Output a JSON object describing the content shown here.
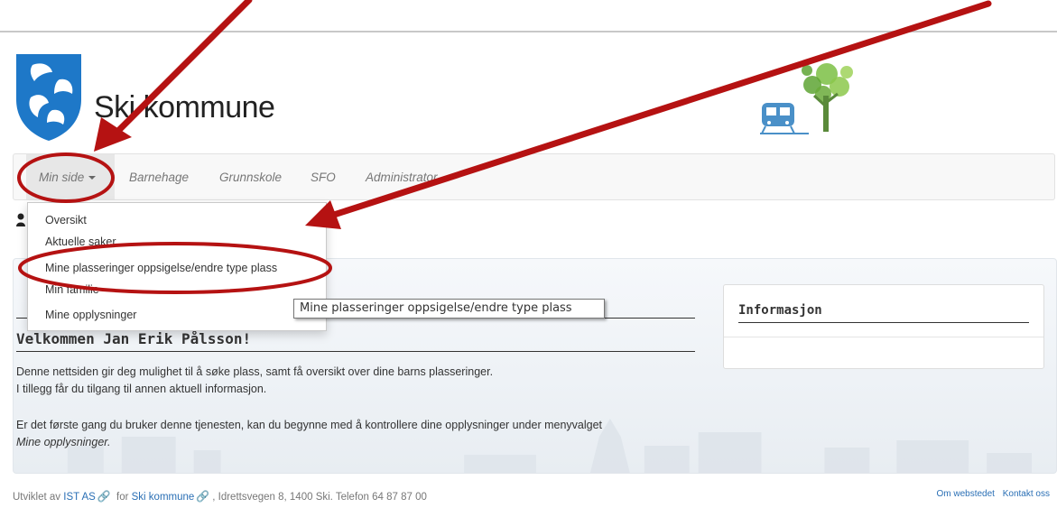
{
  "header": {
    "site_title": "Ski kommune"
  },
  "nav": {
    "items": [
      {
        "label": "Min side"
      },
      {
        "label": "Barnehage"
      },
      {
        "label": "Grunnskole"
      },
      {
        "label": "SFO"
      },
      {
        "label": "Administrator"
      }
    ]
  },
  "dropdown": {
    "items": [
      {
        "label": "Oversikt"
      },
      {
        "label": "Aktuelle saker"
      },
      {
        "label": "Mine plasseringer oppsigelse/endre type plass"
      },
      {
        "label": "Min familie"
      },
      {
        "label": "Mine opplysninger"
      }
    ]
  },
  "tooltip": {
    "text": "Mine plasseringer oppsigelse/endre type plass"
  },
  "main": {
    "welcome": "Velkommen Jan Erik Pålsson!",
    "paragraph1_line1": "Denne nettsiden gir deg mulighet til å søke plass, samt få oversikt over dine barns plasseringer.",
    "paragraph1_line2": "I tillegg får du tilgang til annen aktuell informasjon.",
    "paragraph2_line1": "Er det første gang du bruker denne tjenesten, kan du begynne med å kontrollere dine opplysninger under menyvalget",
    "paragraph2_line2": "Mine opplysninger."
  },
  "info_box": {
    "title": "Informasjon"
  },
  "footer": {
    "prefix": "Utviklet av",
    "company_link": "IST AS",
    "for_text": "for",
    "kommune_link": "Ski kommune",
    "address": ", Idrettsvegen 8, 1400 Ski. Telefon 64 87 87 00",
    "link_about": "Om webstedet",
    "link_contact": "Kontakt oss"
  },
  "colors": {
    "annotation_red": "#b51212",
    "crest_blue": "#1e78c8",
    "link_blue": "#2a6fb5",
    "tree_green": "#6aaa3a",
    "train_blue": "#4a90c8"
  }
}
